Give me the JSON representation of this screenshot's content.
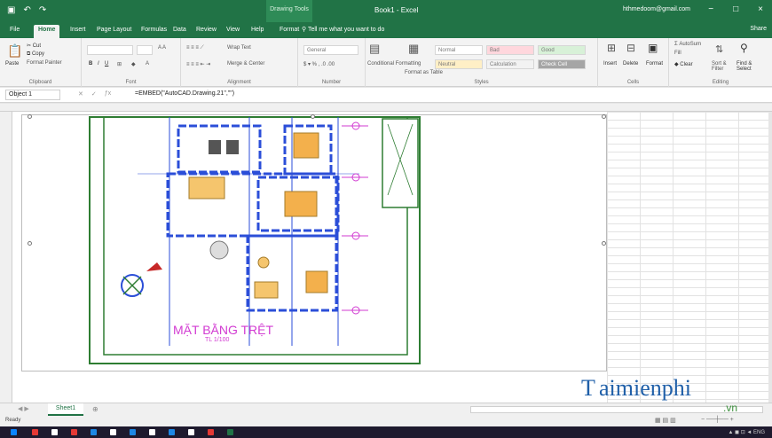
{
  "titlebar": {
    "context_tab": "Drawing Tools",
    "document_title": "Book1 - Excel",
    "account": "hthmedoom@gmail.com",
    "window_controls": [
      "−",
      "□",
      "×"
    ]
  },
  "tabs": [
    "File",
    "Home",
    "Insert",
    "Page Layout",
    "Formulas",
    "Data",
    "Review",
    "View",
    "Help",
    "Format"
  ],
  "active_tab": "Home",
  "tell_me": "Tell me what you want to do",
  "share": "Share",
  "ribbon": {
    "clipboard": {
      "paste": "Paste",
      "cut": "Cut",
      "copy": "Copy",
      "format_painter": "Format Painter",
      "label": "Clipboard"
    },
    "font": {
      "label": "Font"
    },
    "alignment": {
      "wrap": "Wrap Text",
      "merge": "Merge & Center",
      "label": "Alignment"
    },
    "number": {
      "format": "General",
      "label": "Number"
    },
    "styles": {
      "conditional": "Conditional Formatting",
      "format_as_table": "Format as Table",
      "cells": [
        "Normal",
        "Bad",
        "Good",
        "Neutral",
        "Calculation",
        "Check Cell"
      ],
      "label": "Styles"
    },
    "cells_group": {
      "insert": "Insert",
      "delete": "Delete",
      "format": "Format",
      "label": "Cells"
    },
    "editing": {
      "autosum": "AutoSum",
      "fill": "Fill",
      "clear": "Clear",
      "sort": "Sort & Filter",
      "find": "Find & Select",
      "label": "Editing"
    }
  },
  "formula_bar": {
    "name_box": "Object 1",
    "formula": "=EMBED(\"AutoCAD.Drawing.21\",\"\")"
  },
  "drawing": {
    "title": "MẶT BẰNG TRỆT",
    "subtitle": "TL 1/100"
  },
  "sheet_tab": "Sheet1",
  "status": "Ready",
  "watermark": {
    "text": "aimienphi",
    "suffix": ".vn"
  },
  "colors": {
    "excel_green": "#217346",
    "plan_walls": "#2b4ed8",
    "plan_border": "#2e7d32",
    "annotations": "#d23bd2"
  }
}
